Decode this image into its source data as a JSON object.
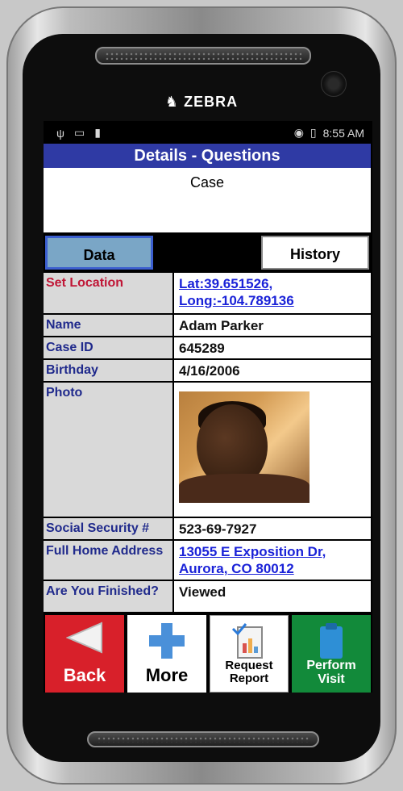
{
  "device": {
    "brand": "ZEBRA"
  },
  "statusbar": {
    "time": "8:55 AM"
  },
  "header": {
    "title": "Details - Questions",
    "subtitle": "Case"
  },
  "tabs": [
    {
      "label": "Data"
    },
    {
      "label": "History"
    }
  ],
  "rows": [
    {
      "label": "Set Location",
      "value": "Lat:39.651526,\nLong:-104.789136"
    },
    {
      "label": "Name",
      "value": "Adam Parker"
    },
    {
      "label": "Case ID",
      "value": "645289"
    },
    {
      "label": "Birthday",
      "value": "4/16/2006"
    },
    {
      "label": "Photo",
      "value": ""
    },
    {
      "label": "Social Security #",
      "value": "523-69-7927"
    },
    {
      "label": "Full Home Address",
      "value": "13055 E Exposition Dr,\nAurora, CO 80012"
    },
    {
      "label": "Are You Finished?",
      "value": "Viewed"
    }
  ],
  "buttons": {
    "back": "Back",
    "more": "More",
    "report": "Request Report",
    "visit": "Perform Visit"
  },
  "colors": {
    "titlebar": "#2f3aa4",
    "back": "#d8202a",
    "visit": "#128a3a",
    "link": "#1a22d8",
    "label_text": "#202a8c",
    "location_label": "#c01636"
  },
  "icons": [
    "usb-icon",
    "screen-icon",
    "sim-icon",
    "wifi-icon",
    "battery-icon",
    "back-arrow-icon",
    "plus-icon",
    "report-icon",
    "clipboard-icon"
  ]
}
